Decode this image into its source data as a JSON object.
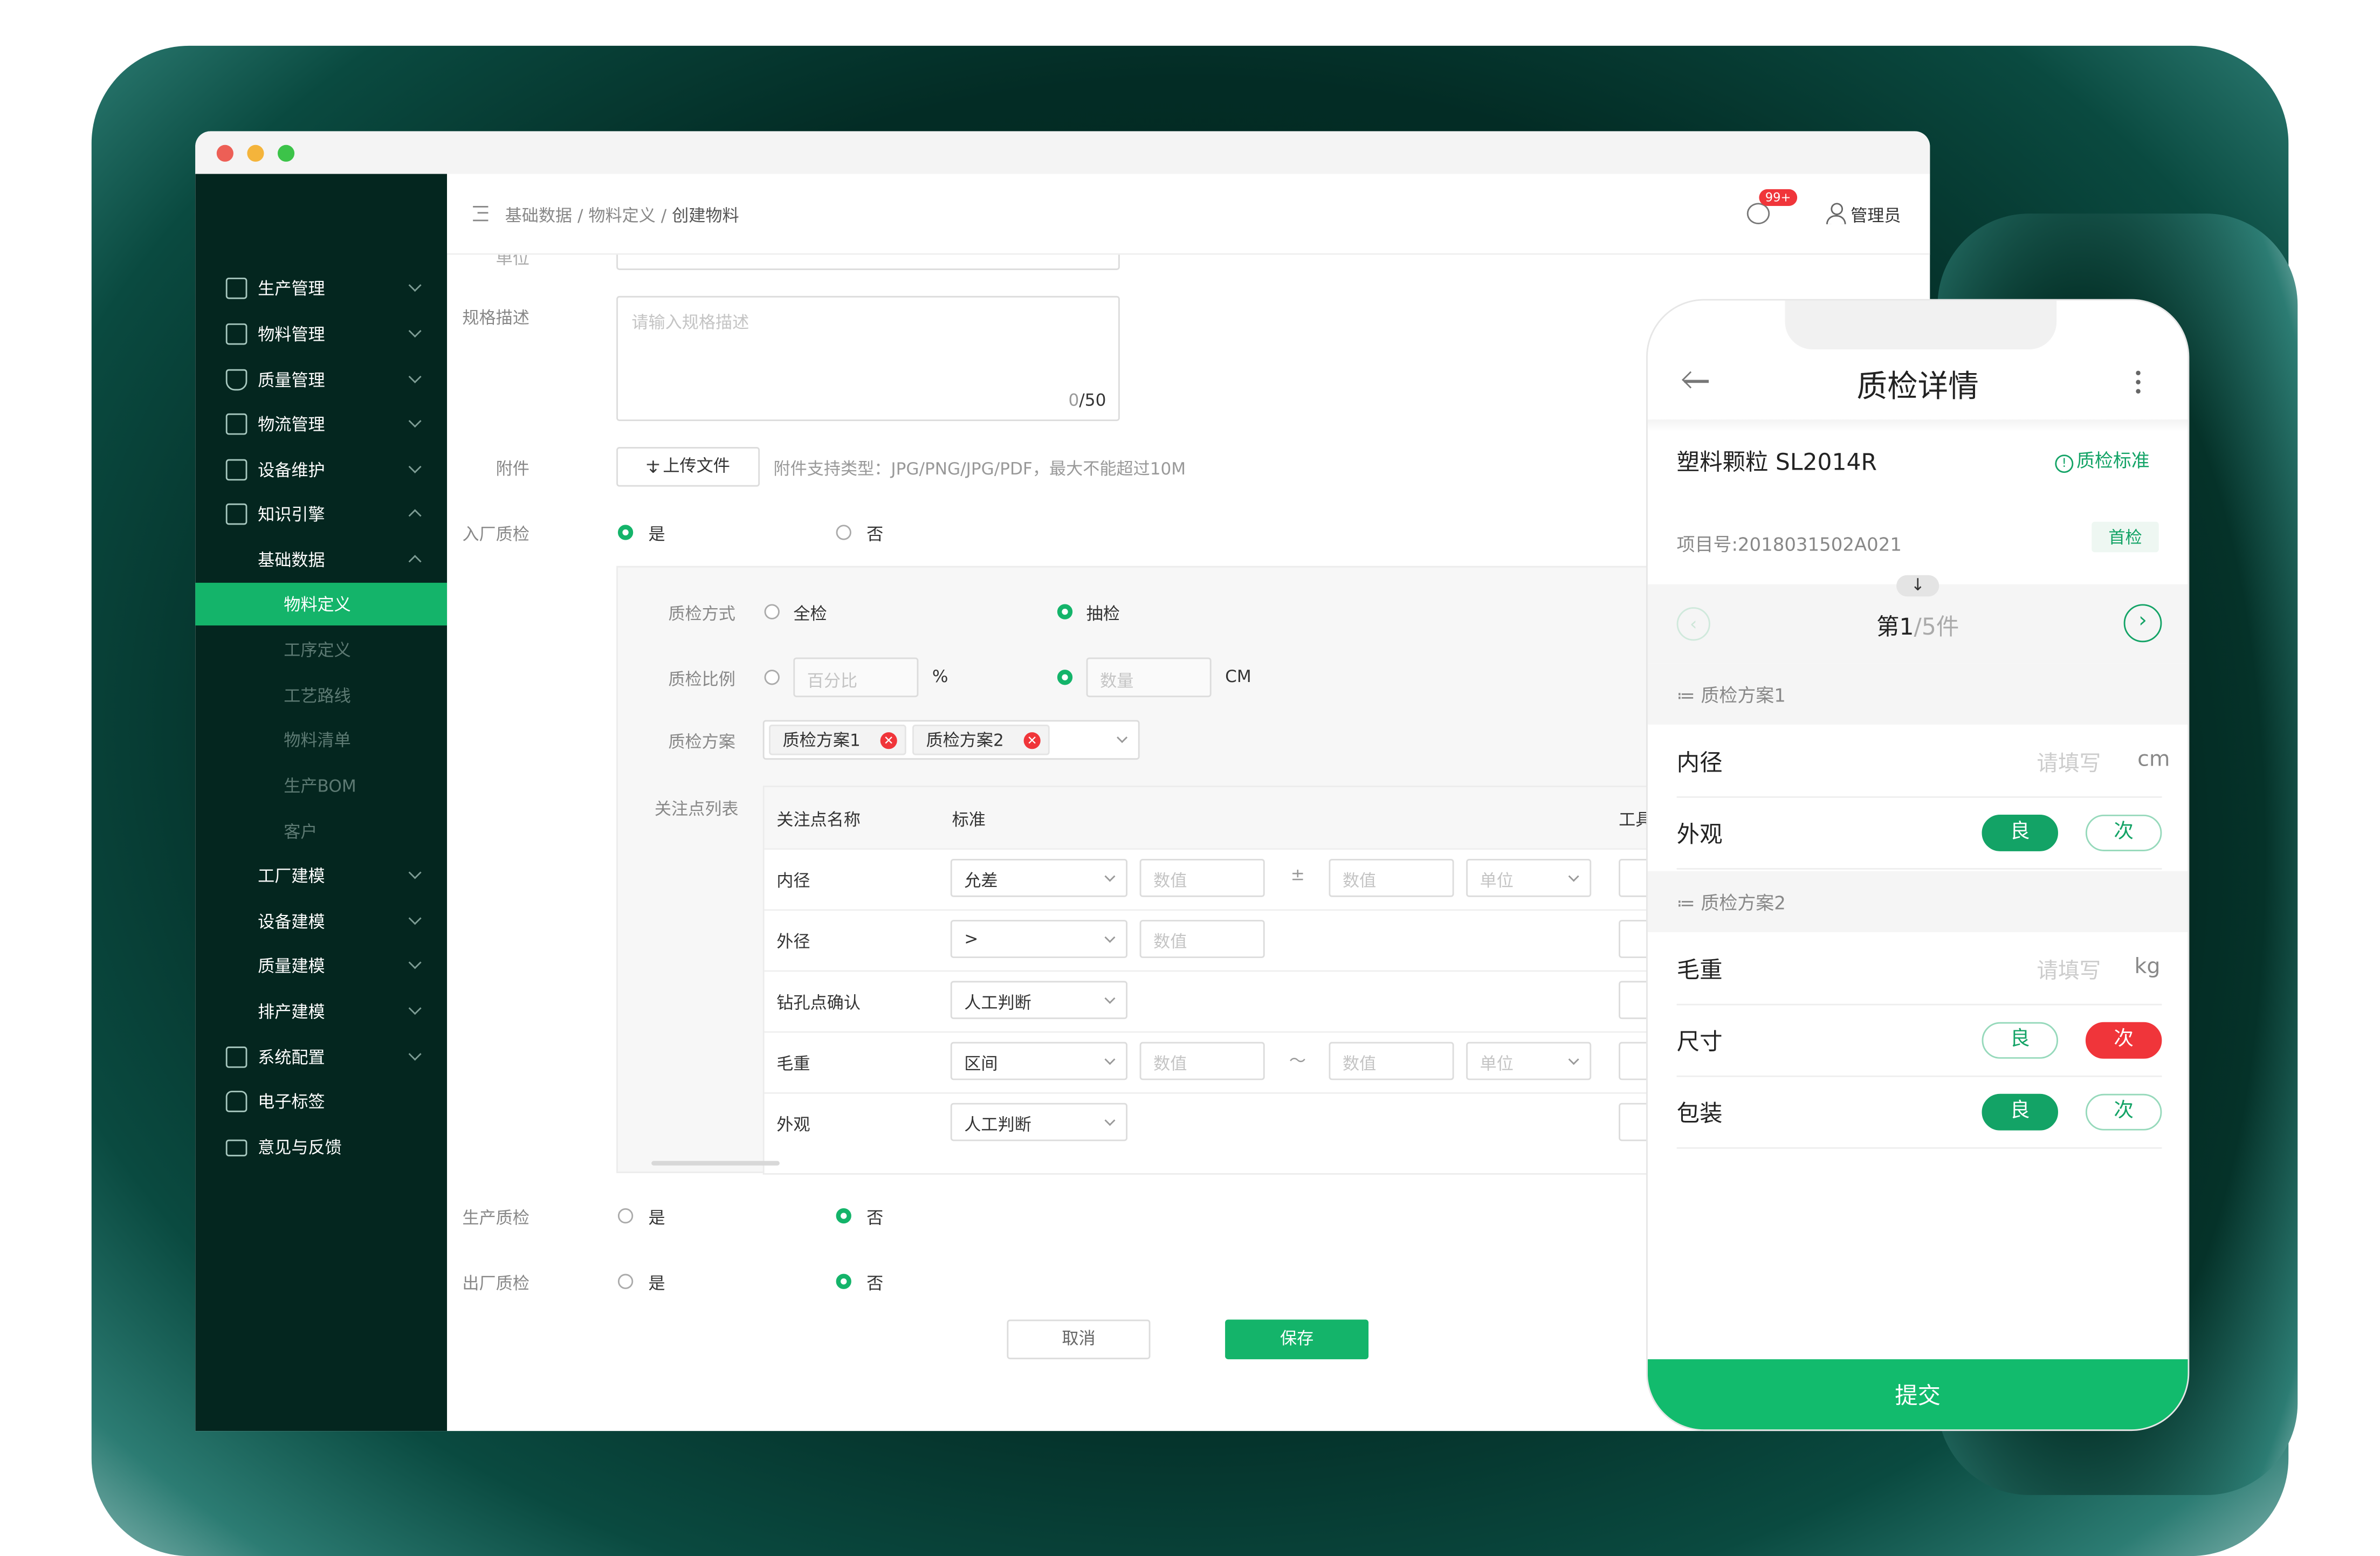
{
  "sidebar": {
    "items": [
      {
        "label": "生产管理"
      },
      {
        "label": "物料管理"
      },
      {
        "label": "质量管理"
      },
      {
        "label": "物流管理"
      },
      {
        "label": "设备维护"
      },
      {
        "label": "知识引擎"
      }
    ],
    "group_label": "基础数据",
    "sub_items": [
      {
        "label": "物料定义"
      },
      {
        "label": "工序定义"
      },
      {
        "label": "工艺路线"
      },
      {
        "label": "物料清单"
      },
      {
        "label": "生产BOM"
      },
      {
        "label": "客户"
      }
    ],
    "more_items": [
      {
        "label": "工厂建模"
      },
      {
        "label": "设备建模"
      },
      {
        "label": "质量建模"
      },
      {
        "label": "排产建模"
      }
    ],
    "bottom_items": [
      {
        "label": "系统配置"
      },
      {
        "label": "电子标签"
      },
      {
        "label": "意见与反馈"
      }
    ]
  },
  "header": {
    "breadcrumb": "基础数据 / 物料定义 / ",
    "breadcrumb_current": "创建物料",
    "badge": "99+",
    "user": "管理员"
  },
  "form": {
    "cut_label": "单位",
    "spec_label": "规格描述",
    "spec_placeholder": "请输入规格描述",
    "spec_counter_zero": "0",
    "spec_counter_max": "/50",
    "attach_label": "附件",
    "upload_button": "上传文件",
    "attach_hint": "附件支持类型：JPG/PNG/JPG/PDF，最大不能超过10M",
    "incoming_label": "入厂质检",
    "yes": "是",
    "no": "否",
    "method_label": "质检方式",
    "method_all": "全检",
    "method_sample": "抽检",
    "ratio_label": "质检比例",
    "ratio_placeholder": "百分比",
    "ratio_unit": "%",
    "count_placeholder": "数量",
    "count_unit": "CM",
    "plan_label": "质检方案",
    "plan_tags": [
      "质检方案1",
      "质检方案2"
    ],
    "points_label": "关注点列表",
    "table_headers": [
      "关注点名称",
      "标准",
      "工具"
    ],
    "value_placeholder": "数值",
    "unit_placeholder": "单位",
    "pm_symbol": "±",
    "range_symbol": "～",
    "rows": [
      {
        "name": "内径",
        "standard": "允差"
      },
      {
        "name": "外径",
        "standard": ">"
      },
      {
        "name": "钻孔点确认",
        "standard": "人工判断"
      },
      {
        "name": "毛重",
        "standard": "区间"
      },
      {
        "name": "外观",
        "standard": "人工判断"
      }
    ],
    "production_label": "生产质检",
    "outgoing_label": "出厂质检",
    "cancel_button": "取消",
    "save_button": "保存"
  },
  "phone": {
    "title": "质检详情",
    "product": "塑料颗粒 SL2014R",
    "standard_link": "质检标准",
    "project_no": "项目号:2018031502A021",
    "first_tag": "首检",
    "pager_prefix": "第",
    "pager_current": "1",
    "pager_rest": "/5件",
    "plan1": "质检方案1",
    "plan2": "质检方案2",
    "fill_placeholder": "请填写",
    "good": "良",
    "bad": "次",
    "rows1": [
      {
        "label": "内径",
        "unit": "cm"
      },
      {
        "label": "外观"
      }
    ],
    "rows2": [
      {
        "label": "毛重",
        "unit": "kg"
      },
      {
        "label": "尺寸"
      },
      {
        "label": "包装"
      }
    ],
    "submit": "提交"
  }
}
